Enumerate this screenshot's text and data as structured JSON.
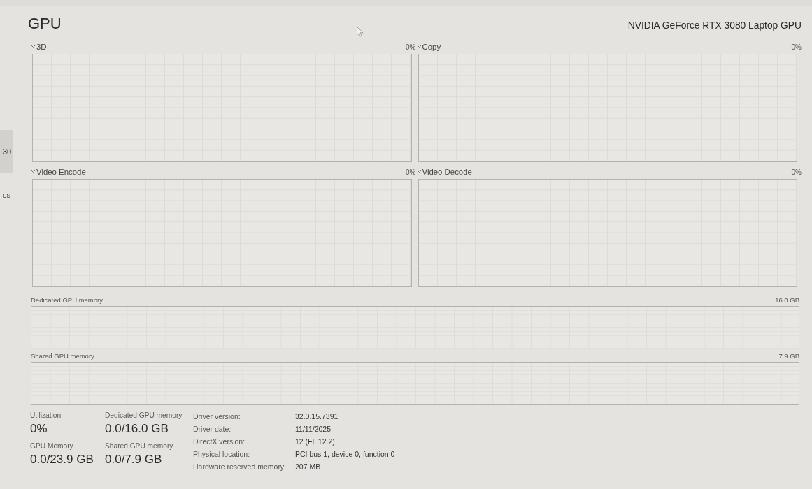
{
  "sidebar": {
    "items": [
      {
        "label": "30",
        "selected": true
      },
      {
        "label": "cs",
        "selected": false
      }
    ]
  },
  "header": {
    "title": "GPU",
    "device_name": "NVIDIA GeForce RTX 3080 Laptop GPU"
  },
  "engines": [
    {
      "name": "3D",
      "reading": "0%"
    },
    {
      "name": "Copy",
      "reading": "0%"
    },
    {
      "name": "Video Encode",
      "reading": "0%"
    },
    {
      "name": "Video Decode",
      "reading": "0%"
    }
  ],
  "memory_graphs": [
    {
      "label": "Dedicated GPU memory",
      "maximum": "16.0 GB"
    },
    {
      "label": "Shared GPU memory",
      "maximum": "7.9 GB"
    }
  ],
  "stats": [
    {
      "label": "Utilization",
      "value": "0%"
    },
    {
      "label": "Dedicated GPU memory",
      "value": "0.0/16.0 GB"
    },
    {
      "label": "GPU Memory",
      "value": "0.0/23.9 GB"
    },
    {
      "label": "Shared GPU memory",
      "value": "0.0/7.9 GB"
    }
  ],
  "properties": [
    {
      "label": "Driver version:",
      "value": "32.0.15.7391"
    },
    {
      "label": "Driver date:",
      "value": "11/11/2025"
    },
    {
      "label": "DirectX version:",
      "value": "12 (FL 12.2)"
    },
    {
      "label": "Physical location:",
      "value": "PCI bus 1, device 0, function 0"
    },
    {
      "label": "Hardware reserved memory:",
      "value": "207 MB"
    }
  ]
}
